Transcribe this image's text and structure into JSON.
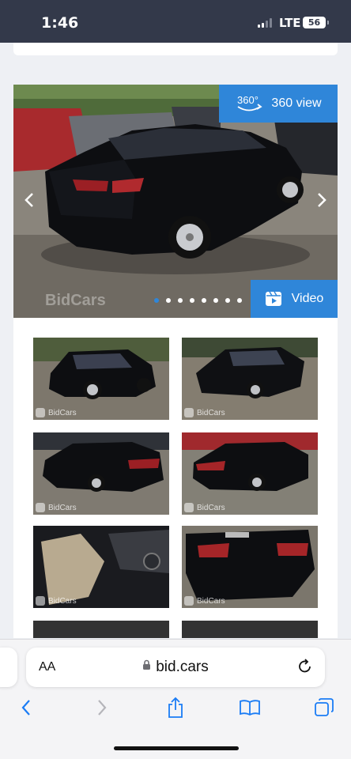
{
  "status_bar": {
    "time": "1:46",
    "network": "LTE",
    "battery": "56"
  },
  "gallery": {
    "view360_badge": "360°",
    "view360_label": "360 view",
    "video_label": "Video",
    "watermark": "BidCars",
    "slide_count": 8,
    "active_slide": 1,
    "thumbnails": [
      {
        "watermark": "BidCars",
        "subject": "front-left exterior"
      },
      {
        "watermark": "BidCars",
        "subject": "front exterior"
      },
      {
        "watermark": "BidCars",
        "subject": "rear-left exterior"
      },
      {
        "watermark": "BidCars",
        "subject": "rear-left exterior"
      },
      {
        "watermark": "BidCars",
        "subject": "front seat interior"
      },
      {
        "watermark": "BidCars",
        "subject": "rear damage Versa"
      }
    ]
  },
  "browser": {
    "aa_label": "AA",
    "url": "bid.cars"
  },
  "colors": {
    "accent": "#2f86d9",
    "status_bar": "#33394a",
    "ios_blue": "#1a7cf5"
  }
}
